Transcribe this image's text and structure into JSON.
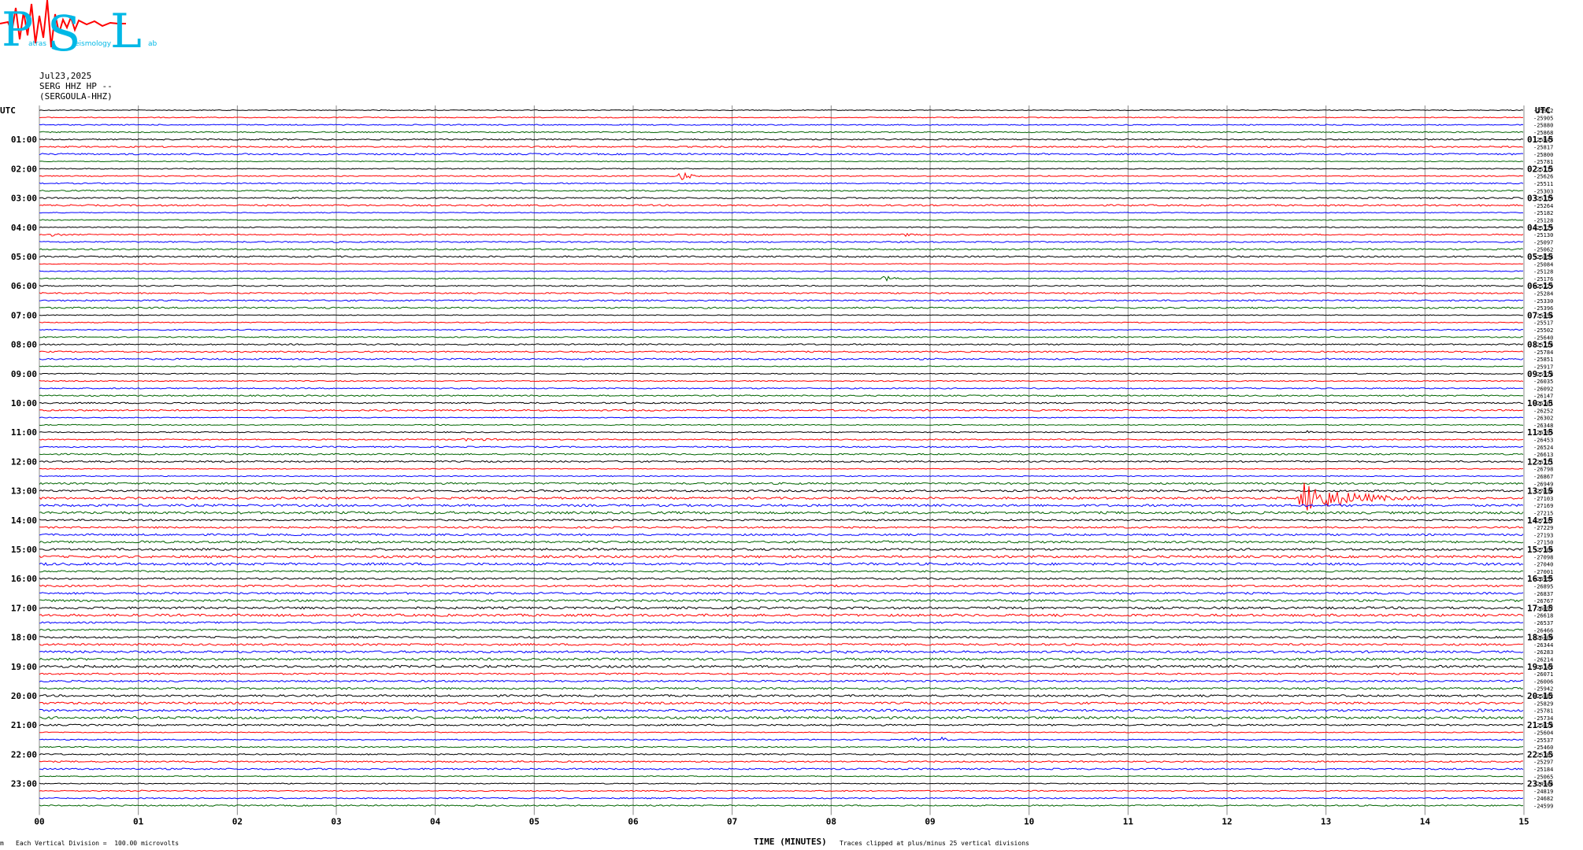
{
  "header": {
    "logo_letters": [
      "P",
      "S",
      "L"
    ],
    "logo_words": [
      "atras",
      "eismology",
      "ab"
    ],
    "date": "Jul23,2025",
    "station": "SERG HHZ HP --",
    "station_name": "(SERGOULA-HHZ)"
  },
  "footer": {
    "scale_note": "Each Vertical Division =  100.00 microvolts",
    "clip_note": "Traces clipped at plus/minus 25 vertical divisions",
    "corner_mark": "m"
  },
  "colors": {
    "trace_cycle": [
      "#000000",
      "#ff0000",
      "#0000ff",
      "#006400"
    ],
    "grid": "#888888",
    "logo_red": "#ff0000",
    "logo_cyan": "#00b8e6"
  },
  "chart_data": {
    "type": "line",
    "title": "",
    "xlabel": "TIME (MINUTES)",
    "ylabel": "",
    "xlim": [
      0,
      15
    ],
    "x_ticks": [
      "00",
      "01",
      "02",
      "03",
      "04",
      "05",
      "06",
      "07",
      "08",
      "09",
      "10",
      "11",
      "12",
      "13",
      "14",
      "15"
    ],
    "left_axis_label": "UTC",
    "right_axis_label": "UTC",
    "left_hour_labels": [
      "01:00",
      "02:00",
      "03:00",
      "04:00",
      "05:00",
      "06:00",
      "07:00",
      "08:00",
      "09:00",
      "10:00",
      "11:00",
      "12:00",
      "13:00",
      "14:00",
      "15:00",
      "16:00",
      "17:00",
      "18:00",
      "19:00",
      "20:00",
      "21:00",
      "22:00",
      "23:00"
    ],
    "right_hour_labels": [
      "01:15",
      "02:15",
      "03:15",
      "04:15",
      "05:15",
      "06:15",
      "07:15",
      "08:15",
      "09:15",
      "10:15",
      "11:15",
      "12:15",
      "13:15",
      "14:15",
      "15:15",
      "16:15",
      "17:15",
      "18:15",
      "19:15",
      "20:15",
      "21:15",
      "22:15",
      "23:15"
    ],
    "traces_per_hour": 4,
    "trace_count": 96,
    "trace_offsets": [
      "-25912",
      "-25905",
      "-25880",
      "-25868",
      "-25843",
      "-25817",
      "-25800",
      "-25781",
      "-25713",
      "-25626",
      "-25511",
      "-25303",
      "-25319",
      "-25264",
      "-25182",
      "-25128",
      "-25129",
      "-25130",
      "-25097",
      "-25062",
      "-25054",
      "-25084",
      "-25128",
      "-25176",
      "-25229",
      "-25284",
      "-25330",
      "-25396",
      "-25456",
      "-25517",
      "-25502",
      "-25640",
      "-25714",
      "-25784",
      "-25851",
      "-25917",
      "-25978",
      "-26035",
      "-26092",
      "-26147",
      "-26201",
      "-26252",
      "-26302",
      "-26348",
      "-26395",
      "-26453",
      "-26524",
      "-26613",
      "-26711",
      "-26798",
      "-26867",
      "-26949",
      "-27030",
      "-27103",
      "-27169",
      "-27215",
      "-27237",
      "-27229",
      "-27193",
      "-27150",
      "-27106",
      "-27098",
      "-27040",
      "-27001",
      "-26955",
      "-26895",
      "-26837",
      "-26767",
      "-26697",
      "-26618",
      "-26537",
      "-26466",
      "-26400",
      "-26344",
      "-26283",
      "-26214",
      "-26142",
      "-26071",
      "-26006",
      "-25942",
      "-25882",
      "-25829",
      "-25781",
      "-25734",
      "-25678",
      "-25604",
      "-25537",
      "-25460",
      "-25383",
      "-25297",
      "-25184",
      "-25065",
      "-24944",
      "-24819",
      "-24682",
      "-24599"
    ],
    "events": [
      {
        "trace": 9,
        "minute": 6.45,
        "duration": 0.25,
        "amplitude": 11
      },
      {
        "trace": 17,
        "minute": 0.1,
        "duration": 0.35,
        "amplitude": 4
      },
      {
        "trace": 17,
        "minute": 8.7,
        "duration": 0.9,
        "amplitude": 2.5
      },
      {
        "trace": 23,
        "minute": 8.5,
        "duration": 0.45,
        "amplitude": 6
      },
      {
        "trace": 26,
        "minute": 6.1,
        "duration": 0.6,
        "amplitude": 3
      },
      {
        "trace": 25,
        "minute": 7.5,
        "duration": 0.05,
        "amplitude": 8
      },
      {
        "trace": 37,
        "minute": 6.05,
        "duration": 0.05,
        "amplitude": 6
      },
      {
        "trace": 44,
        "minute": 12.8,
        "duration": 0.3,
        "amplitude": 3
      },
      {
        "trace": 45,
        "minute": 4.2,
        "duration": 2.2,
        "amplitude": 2
      },
      {
        "trace": 53,
        "minute": 12.7,
        "duration": 1.4,
        "amplitude": 24
      },
      {
        "trace": 59,
        "minute": 1.0,
        "duration": 0.6,
        "amplitude": 3
      },
      {
        "trace": 59,
        "minute": 8.5,
        "duration": 0.5,
        "amplitude": 3
      },
      {
        "trace": 62,
        "minute": 0.0,
        "duration": 0.3,
        "amplitude": 4
      },
      {
        "trace": 74,
        "minute": 8.1,
        "duration": 0.6,
        "amplitude": 2.5
      },
      {
        "trace": 74,
        "minute": 8.5,
        "duration": 0.3,
        "amplitude": 4
      },
      {
        "trace": 79,
        "minute": 9.2,
        "duration": 0.5,
        "amplitude": 3
      },
      {
        "trace": 82,
        "minute": 14.5,
        "duration": 0.5,
        "amplitude": 3
      },
      {
        "trace": 86,
        "minute": 8.8,
        "duration": 0.5,
        "amplitude": 3
      },
      {
        "trace": 86,
        "minute": 9.1,
        "duration": 0.25,
        "amplitude": 4
      },
      {
        "trace": 93,
        "minute": 1.02,
        "duration": 0.04,
        "amplitude": 5
      }
    ]
  }
}
